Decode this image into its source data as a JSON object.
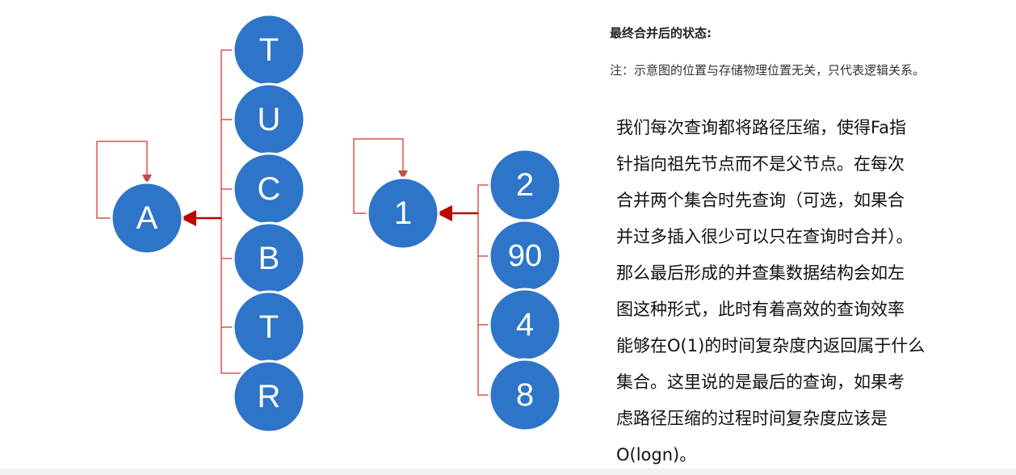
{
  "heading": "最终合并后的状态:",
  "note": "注：示意图的位置与存储物理位置无关，只代表逻辑关系。",
  "left_tree": {
    "root": "A",
    "children": [
      "T",
      "U",
      "C",
      "B",
      "T",
      "R"
    ]
  },
  "right_tree": {
    "root": "1",
    "children": [
      "2",
      "90",
      "4",
      "8"
    ]
  },
  "body_lines": [
    "我们每次查询都将路径压缩，使得Fa指",
    "针指向祖先节点而不是父节点。在每次",
    "合并两个集合时先查询（可选，如果合",
    "并过多插入很少可以只在查询时合并）。",
    "那么最后形成的并查集数据结构会如左",
    "图这种形式，此时有着高效的查询效率",
    "能够在O(1)的时间复杂度内返回属于什么",
    "集合。这里说的是最后的查询，如果考",
    "虑路径压缩的过程时间复杂度应该是",
    "O(logn)。"
  ],
  "colors": {
    "node_fill": "#2e75c9",
    "connector": "#d9534f",
    "arrow": "#c00000"
  }
}
